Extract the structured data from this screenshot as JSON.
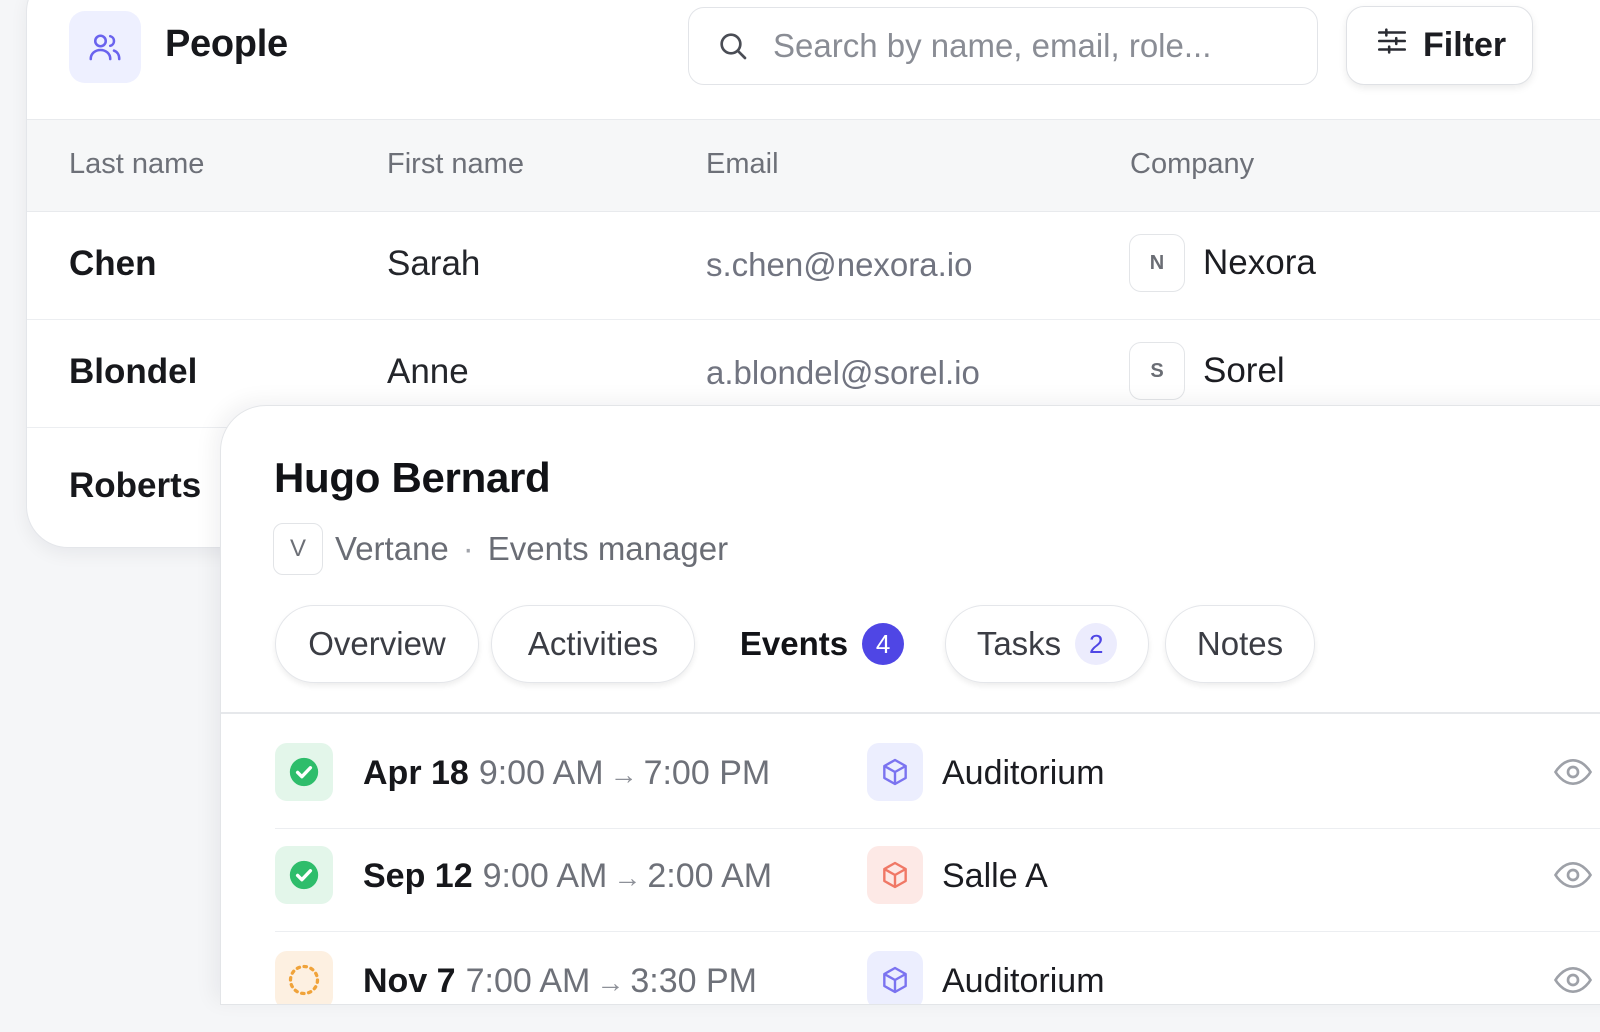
{
  "header": {
    "title": "People",
    "search_placeholder": "Search by name, email, role...",
    "filter_label": "Filter",
    "accent": "#4f46e5"
  },
  "table": {
    "columns": [
      "Last name",
      "First name",
      "Email",
      "Company"
    ],
    "rows": [
      {
        "last_name": "Chen",
        "first_name": "Sarah",
        "email": "s.chen@nexora.io",
        "company_initial": "N",
        "company": "Nexora"
      },
      {
        "last_name": "Blondel",
        "first_name": "Anne",
        "email": "a.blondel@sorel.io",
        "company_initial": "S",
        "company": "Sorel"
      },
      {
        "last_name": "Roberts"
      }
    ]
  },
  "detail": {
    "name": "Hugo Bernard",
    "company_initial": "V",
    "company": "Vertane",
    "separator": "·",
    "role": "Events manager",
    "tabs": [
      {
        "label": "Overview"
      },
      {
        "label": "Activities"
      },
      {
        "label": "Events",
        "count": "4",
        "active": true
      },
      {
        "label": "Tasks",
        "count": "2"
      },
      {
        "label": "Notes"
      }
    ],
    "events": [
      {
        "status": "done",
        "date": "Apr 18",
        "start": "9:00 AM",
        "end": "7:00 PM",
        "venue": "Auditorium",
        "venue_color": "purple"
      },
      {
        "status": "done",
        "date": "Sep 12",
        "start": "9:00 AM",
        "end": "2:00 AM",
        "venue": "Salle A",
        "venue_color": "red"
      },
      {
        "status": "pending",
        "date": "Nov 7",
        "start": "7:00 AM",
        "end": "3:30 PM",
        "venue": "Auditorium",
        "venue_color": "purple"
      }
    ]
  },
  "colors": {
    "success": "#2ebd6b",
    "pending": "#f0a33a",
    "venue_purple": "#7b73f0",
    "venue_red": "#f07866"
  }
}
